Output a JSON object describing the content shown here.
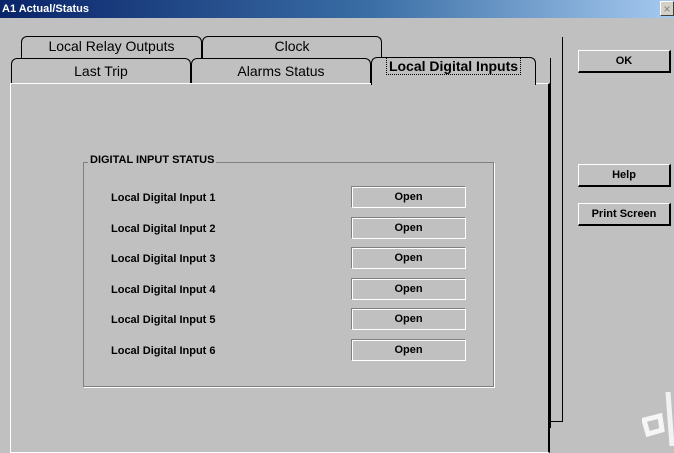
{
  "window": {
    "title": "A1 Actual/Status",
    "close_label": "×"
  },
  "tabs": {
    "back_row": [
      {
        "label": "Local Relay Outputs"
      },
      {
        "label": "Clock"
      }
    ],
    "front_row": [
      {
        "label": "Last Trip"
      },
      {
        "label": "Alarms Status"
      },
      {
        "label": "Local Digital Inputs",
        "active": true
      }
    ]
  },
  "group": {
    "title": "DIGITAL INPUT STATUS",
    "rows": [
      {
        "label": "Local Digital Input 1",
        "value": "Open"
      },
      {
        "label": "Local Digital Input 2",
        "value": "Open"
      },
      {
        "label": "Local Digital Input 3",
        "value": "Open"
      },
      {
        "label": "Local Digital Input 4",
        "value": "Open"
      },
      {
        "label": "Local Digital Input 5",
        "value": "Open"
      },
      {
        "label": "Local Digital Input 6",
        "value": "Open"
      }
    ]
  },
  "buttons": {
    "ok": "OK",
    "help": "Help",
    "print": "Print Screen"
  },
  "colors": {
    "face": "#c0c0c0",
    "title_start": "#0a246a",
    "title_end": "#a6caf0"
  }
}
